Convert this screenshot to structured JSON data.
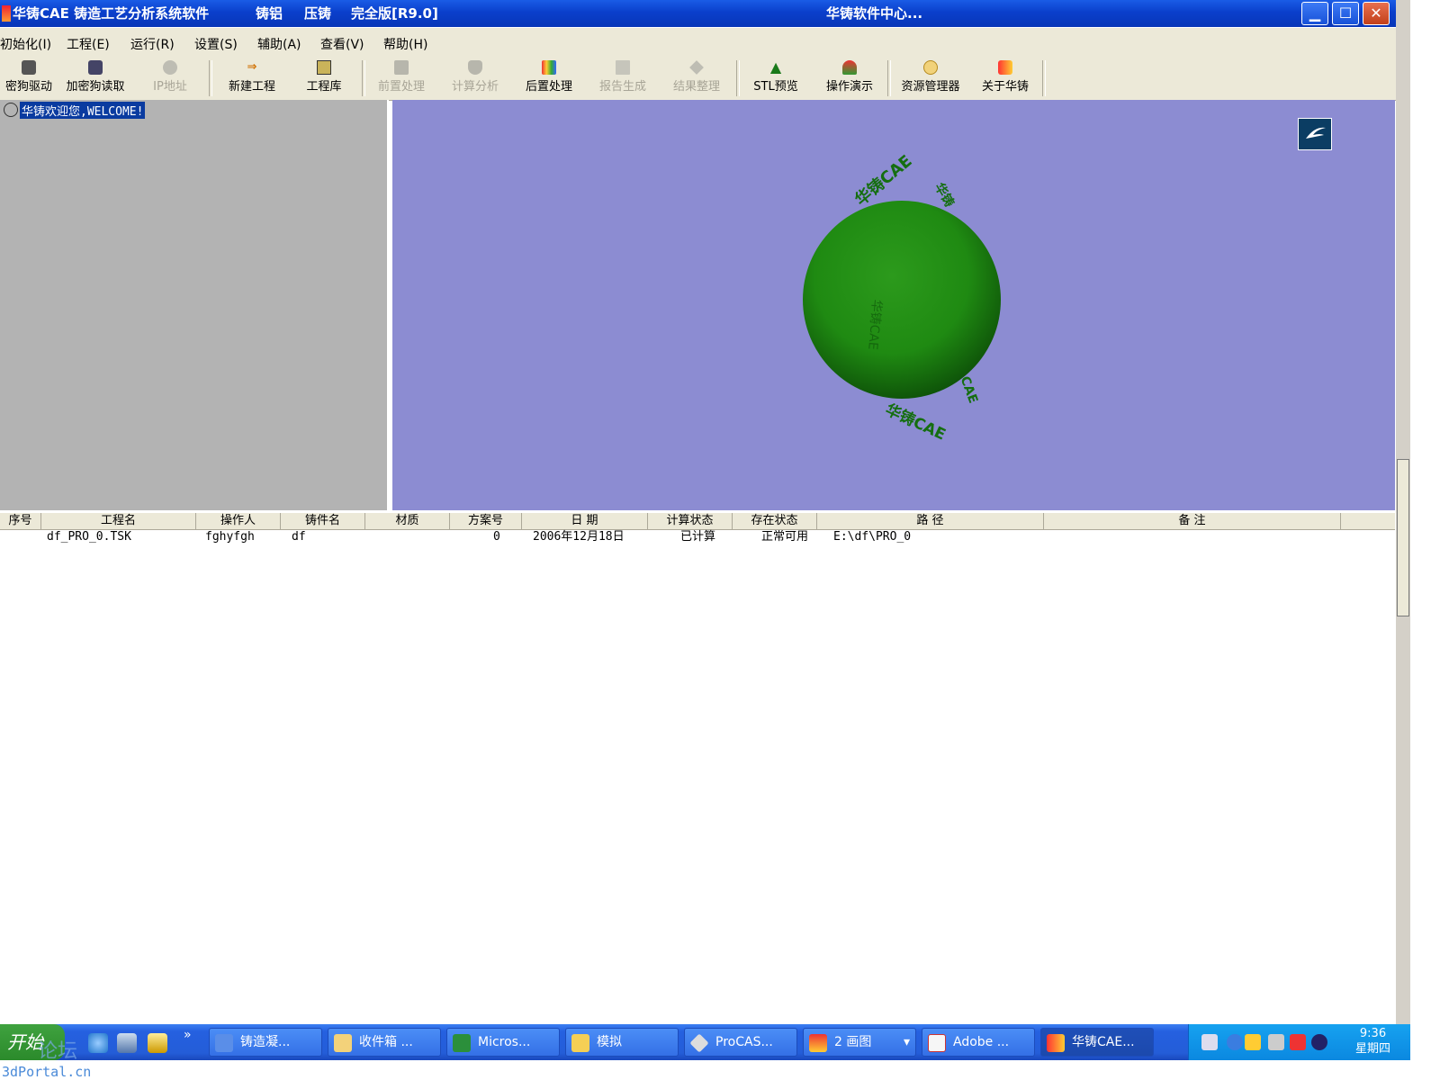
{
  "titlebar": {
    "title": "华铸CAE 铸造工艺分析系统软件",
    "variant1": "铸铝",
    "variant2": "压铸",
    "edition": "完全版[R9.0]",
    "center_text": "华铸软件中心..."
  },
  "menu": [
    "初始化(I)",
    "工程(E)",
    "运行(R)",
    "设置(S)",
    "辅助(A)",
    "查看(V)",
    "帮助(H)"
  ],
  "toolbar": [
    {
      "label": "密狗驱动",
      "enabled": true
    },
    {
      "label": "加密狗读取",
      "enabled": true
    },
    {
      "label": "IP地址",
      "enabled": false
    },
    {
      "label": "新建工程",
      "enabled": true
    },
    {
      "label": "工程库",
      "enabled": true
    },
    {
      "label": "前置处理",
      "enabled": false
    },
    {
      "label": "计算分析",
      "enabled": false
    },
    {
      "label": "后置处理",
      "enabled": true
    },
    {
      "label": "报告生成",
      "enabled": false
    },
    {
      "label": "结果整理",
      "enabled": false
    },
    {
      "label": "STL预览",
      "enabled": true
    },
    {
      "label": "操作演示",
      "enabled": true
    },
    {
      "label": "资源管理器",
      "enabled": true
    },
    {
      "label": "关于华铸",
      "enabled": true
    }
  ],
  "tree": {
    "selected_label": "华铸欢迎您,WELCOME!"
  },
  "viewport": {
    "background": "#8c8cd2",
    "sphere_color": "#1f8a12",
    "orbit_text": "华铸CAE"
  },
  "table": {
    "columns": [
      "序号",
      "工程名",
      "操作人",
      "铸件名",
      "材质",
      "方案号",
      "日  期",
      "计算状态",
      "存在状态",
      "路    径",
      "备 注"
    ],
    "rows": [
      {
        "index": "",
        "project": "df_PRO_0.TSK",
        "operator": "fghyfgh",
        "casting": "df",
        "material": "",
        "scheme": "0",
        "date": "2006年12月18日",
        "calc_status": "已计算",
        "exist_status": "正常可用",
        "path": "E:\\df\\PRO_0",
        "note": ""
      }
    ]
  },
  "taskbar": {
    "start_label": "开始",
    "more": "»",
    "tasks": [
      "铸造凝...",
      "收件箱 ...",
      "Micros...",
      "模拟",
      "ProCAS...",
      "2 画图",
      "Adobe ...",
      "华铸CAE..."
    ],
    "active_task": "华铸CAE...",
    "clock_time": "9:36",
    "clock_day": "星期四"
  },
  "watermark": {
    "text": "3dPortal.cn",
    "overlay": "论坛"
  },
  "colors": {
    "titlebar": "#0a3fcb",
    "menubar": "#ece9d8",
    "tree_bg": "#b3b3b3",
    "selection": "#0a3ba0",
    "taskbar": "#245dd8"
  }
}
